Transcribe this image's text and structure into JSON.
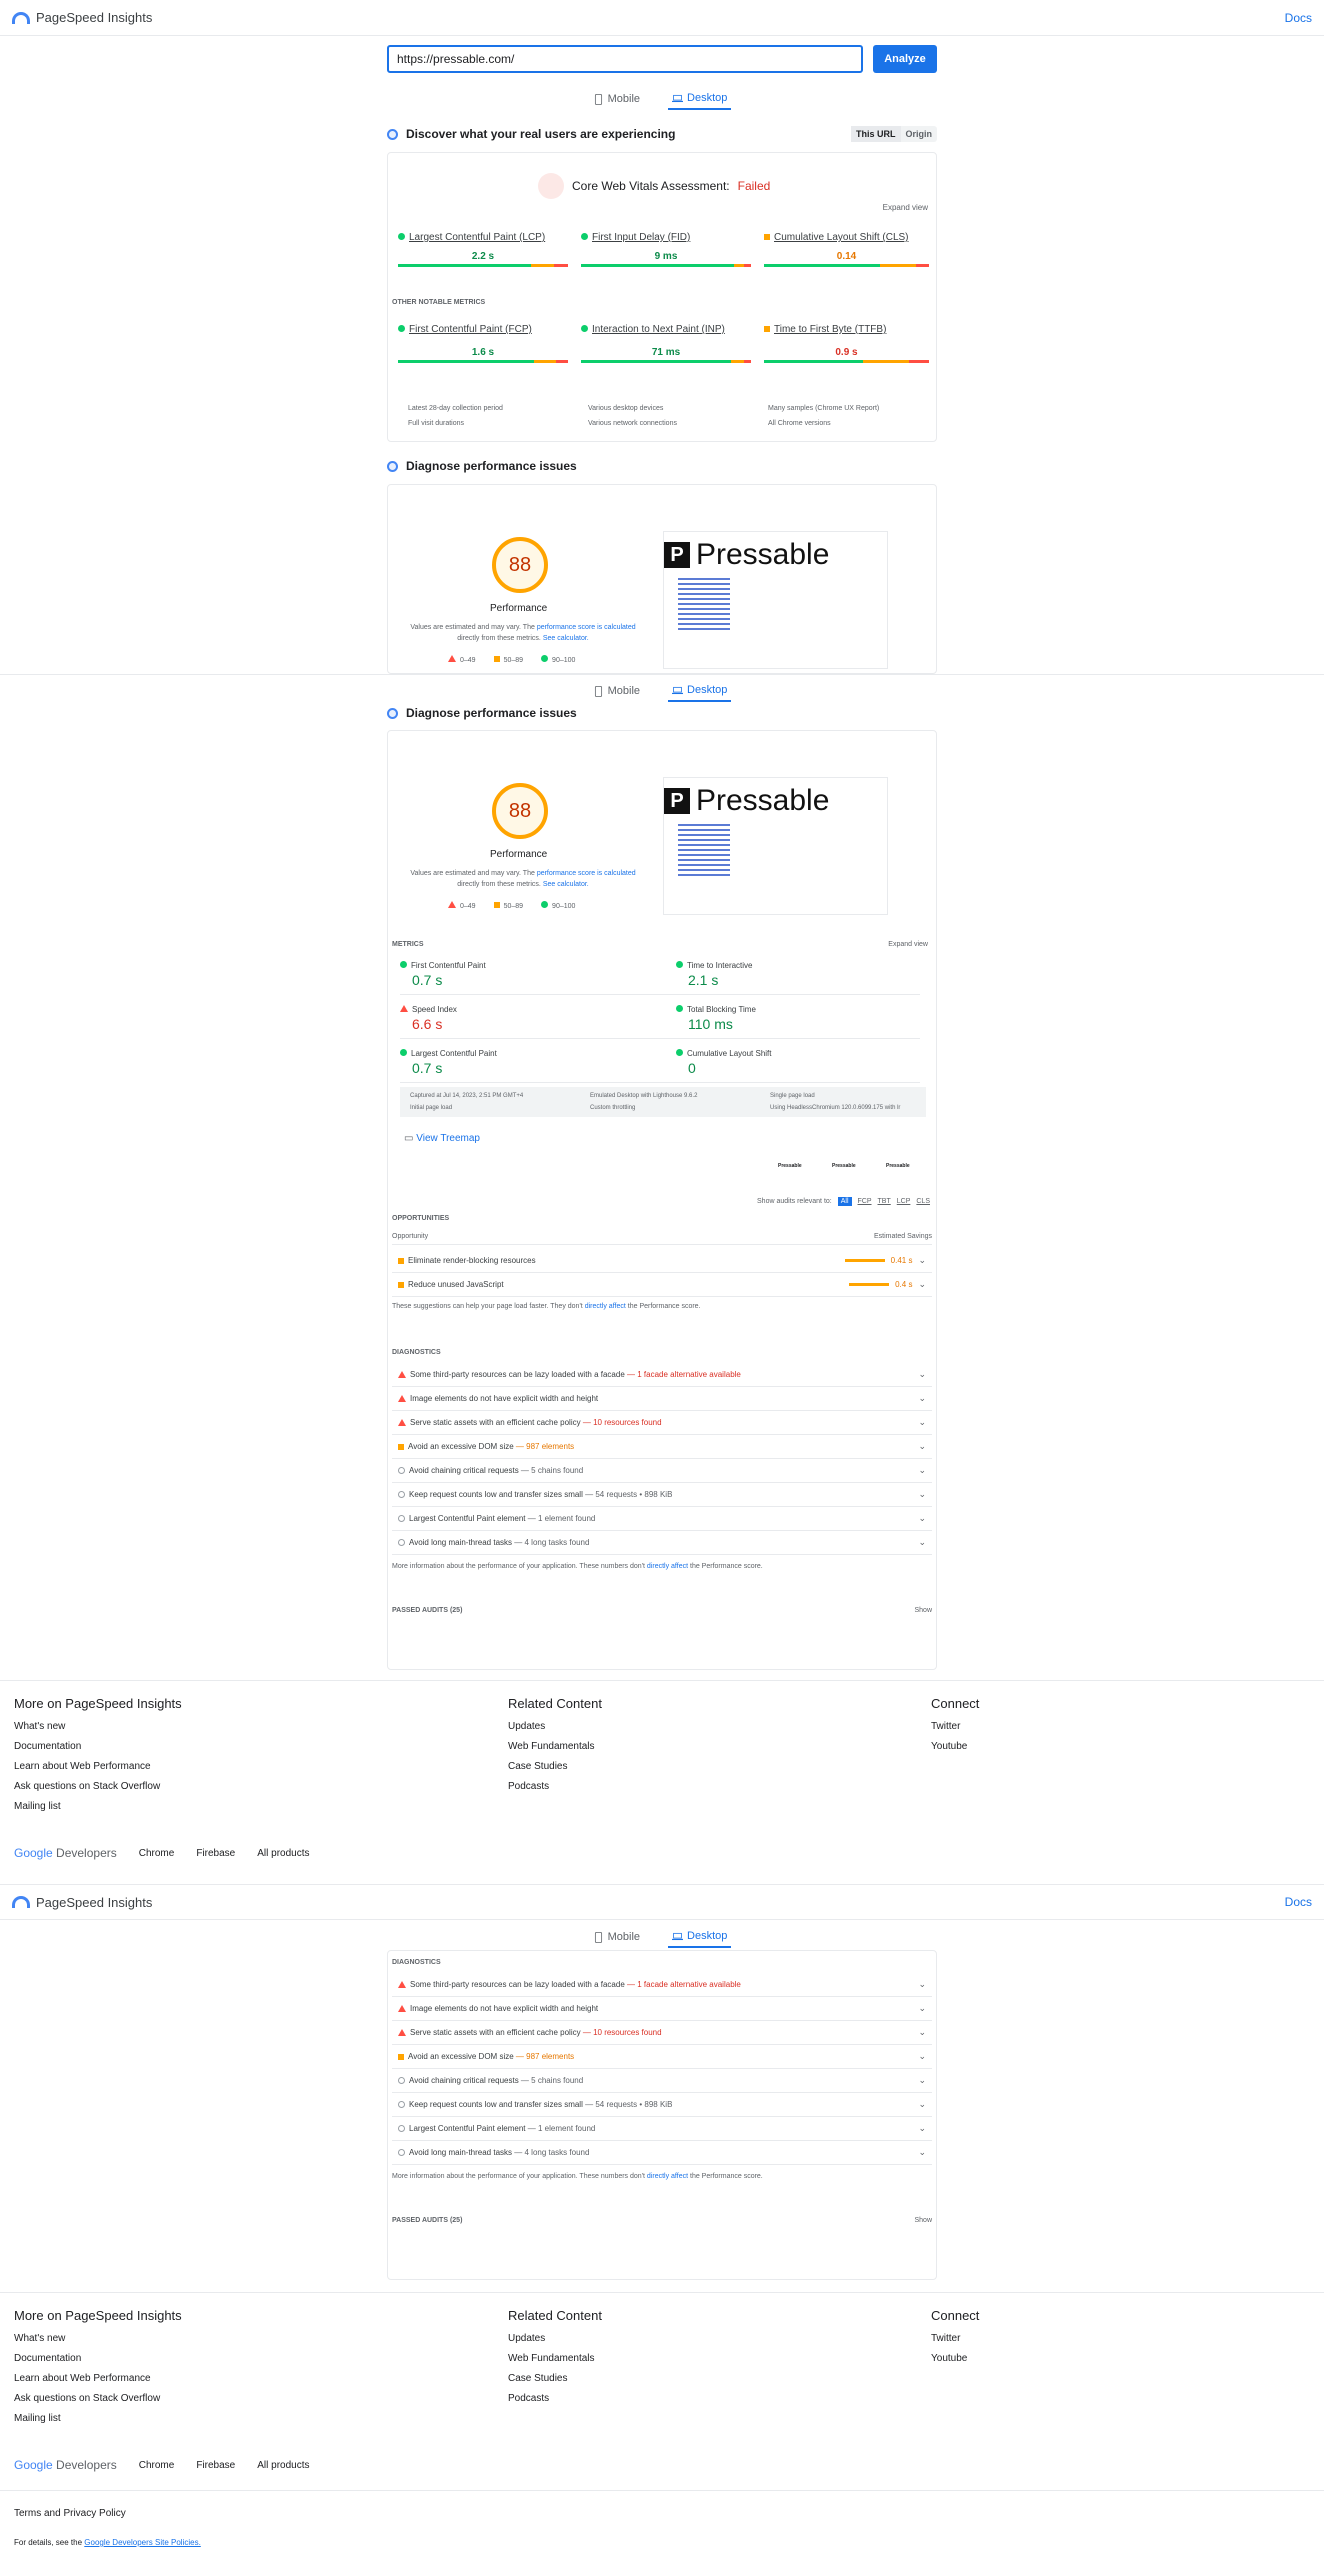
{
  "header": {
    "title": "PageSpeed Insights",
    "docs": "Docs"
  },
  "url": {
    "value": "https://pressable.com/",
    "analyze": "Analyze"
  },
  "tabs": {
    "mobile": "Mobile",
    "desktop": "Desktop"
  },
  "crux": {
    "title": "Discover what your real users are experiencing",
    "seg_url": "This URL",
    "seg_origin": "Origin",
    "assessment_label": "Core Web Vitals Assessment:",
    "assessment_value": "Failed",
    "expand": "Expand view",
    "metrics": [
      {
        "name": "Largest Contentful Paint (LCP)",
        "value": "2.2 s"
      },
      {
        "name": "First Input Delay (FID)",
        "value": "9 ms"
      },
      {
        "name": "Cumulative Layout Shift (CLS)",
        "value": "0.14"
      }
    ],
    "other_label": "OTHER NOTABLE METRICS",
    "other": [
      {
        "name": "First Contentful Paint (FCP)",
        "value": "1.6 s"
      },
      {
        "name": "Interaction to Next Paint (INP)",
        "value": "71 ms"
      },
      {
        "name": "Time to First Byte (TTFB)",
        "value": "0.9 s"
      }
    ],
    "info": [
      "Latest 28-day collection period",
      "Various desktop devices",
      "Many samples (Chrome UX Report)",
      "Full visit durations",
      "Various network connections",
      "All Chrome versions"
    ]
  },
  "diag": {
    "title": "Diagnose performance issues",
    "score": "88",
    "score_label": "Performance",
    "note1": "Values are estimated and may vary. The",
    "note_link": "performance score is calculated",
    "note2": "directly from these metrics.",
    "see_calc": "See calculator.",
    "legend": [
      "0–49",
      "50–89",
      "90–100"
    ],
    "brand": "Pressable",
    "brand_mark": "P"
  },
  "lab": {
    "metrics_label": "METRICS",
    "expand": "Expand view",
    "items": [
      {
        "name": "First Contentful Paint",
        "value": "0.7 s"
      },
      {
        "name": "Time to Interactive",
        "value": "2.1 s"
      },
      {
        "name": "Speed Index",
        "value": "6.6 s"
      },
      {
        "name": "Total Blocking Time",
        "value": "110 ms"
      },
      {
        "name": "Largest Contentful Paint",
        "value": "0.7 s"
      },
      {
        "name": "Cumulative Layout Shift",
        "value": "0"
      }
    ],
    "env": [
      "Captured at Jul 14, 2023, 2:51 PM GMT+4",
      "Emulated Desktop with Lighthouse 9.6.2",
      "Single page load",
      "Initial page load",
      "Custom throttling",
      "Using HeadlessChromium 120.0.6099.175 with lr"
    ],
    "treemap": "View Treemap",
    "show_audits": "Show audits relevant to:",
    "filters": [
      "All",
      "FCP",
      "TBT",
      "LCP",
      "CLS"
    ],
    "opp_label": "OPPORTUNITIES",
    "opp_col1": "Opportunity",
    "opp_col2": "Estimated Savings",
    "opps": [
      {
        "name": "Eliminate render-blocking resources",
        "value": "0.41 s"
      },
      {
        "name": "Reduce unused JavaScript",
        "value": "0.4 s"
      }
    ],
    "opp_note1": "These suggestions can help your page load faster. They don't",
    "opp_note_link": "directly affect",
    "opp_note2": "the Performance score.",
    "diag_label": "DIAGNOSTICS",
    "diags": [
      {
        "name": "Some third-party resources can be lazy loaded with a facade",
        "detail": "— 1 facade alternative available"
      },
      {
        "name": "Image elements do not have explicit width and height",
        "detail": ""
      },
      {
        "name": "Serve static assets with an efficient cache policy",
        "detail": "— 10 resources found"
      },
      {
        "name": "Avoid an excessive DOM size",
        "detail": "— 987 elements"
      },
      {
        "name": "Avoid chaining critical requests",
        "detail": "— 5 chains found"
      },
      {
        "name": "Keep request counts low and transfer sizes small",
        "detail": "— 54 requests • 898 KiB"
      },
      {
        "name": "Largest Contentful Paint element",
        "detail": "— 1 element found"
      },
      {
        "name": "Avoid long main-thread tasks",
        "detail": "— 4 long tasks found"
      }
    ],
    "diag_note1": "More information about the performance of your application. These numbers don't",
    "diag_note_link": "directly affect",
    "diag_note2": "the Performance score.",
    "passed": "PASSED AUDITS (25)",
    "show": "Show"
  },
  "footer": {
    "col1_title": "More on PageSpeed Insights",
    "col1": [
      "What's new",
      "Documentation",
      "Learn about Web Performance",
      "Ask questions on Stack Overflow",
      "Mailing list"
    ],
    "col2_title": "Related Content",
    "col2": [
      "Updates",
      "Web Fundamentals",
      "Case Studies",
      "Podcasts"
    ],
    "col3_title": "Connect",
    "col3": [
      "Twitter",
      "Youtube"
    ],
    "google": "Google",
    "developers": "Developers",
    "links": [
      "Chrome",
      "Firebase",
      "All products"
    ],
    "terms": "Terms and Privacy Policy",
    "details_pre": "For details, see the",
    "details_link": "Google Developers Site Policies."
  },
  "colors": {
    "accent": "#1a73e8",
    "good": "#0cce6b",
    "avg": "#ffa400",
    "poor": "#ff4e42"
  }
}
